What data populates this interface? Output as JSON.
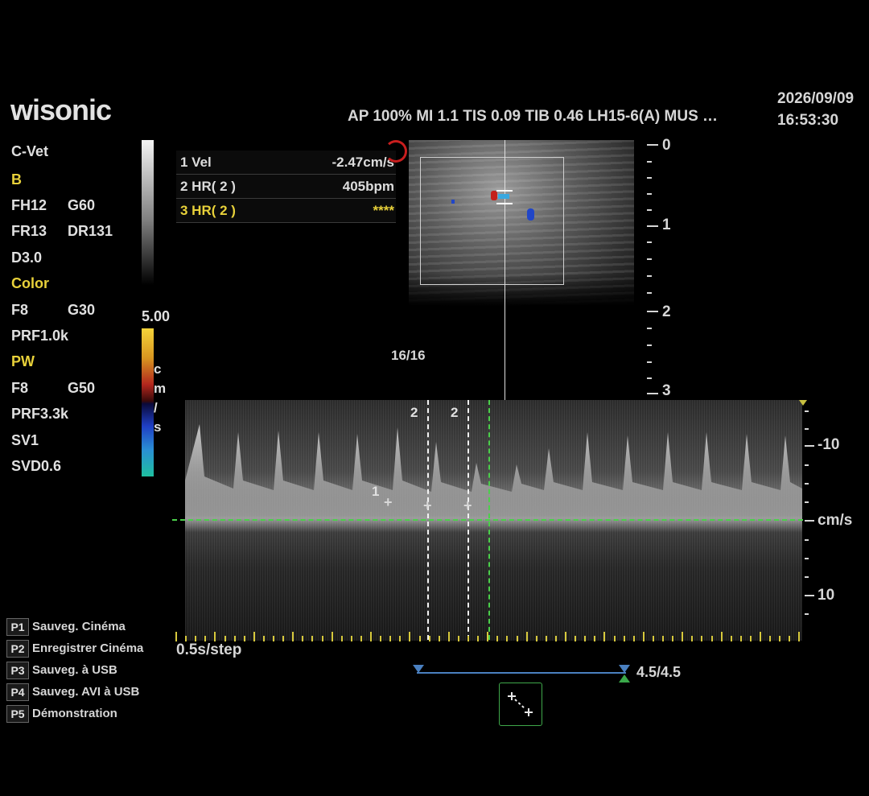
{
  "brand": {
    "logo": "wisonic"
  },
  "header": {
    "acoustic_params": "AP 100% MI 1.1 TIS 0.09  TIB 0.46  LH15-6(A)  MUS …",
    "date": "2026/09/09",
    "time": "16:53:30"
  },
  "params": {
    "preset": "C-Vet",
    "b_mode": {
      "title": "B",
      "fh": "FH12",
      "g": "G60",
      "fr": "FR13",
      "dr": "DR131",
      "d": "D3.0"
    },
    "color_mode": {
      "title": "Color",
      "f": "F8",
      "g": "G30",
      "prf": "PRF1.0k"
    },
    "pw_mode": {
      "title": "PW",
      "f": "F8",
      "g": "G50",
      "prf": "PRF3.3k",
      "sv": "SV1",
      "svd": "SVD0.6"
    }
  },
  "color_scale": {
    "max": "5.00",
    "unit_chars": [
      "c",
      "m",
      "/",
      "s"
    ]
  },
  "measurements": [
    {
      "label": "1 Vel",
      "value": "-2.47cm/s",
      "active": false
    },
    {
      "label": "2 HR( 2 )",
      "value": "405bpm",
      "active": false
    },
    {
      "label": "3 HR( 2 )",
      "value": "****",
      "active": true
    }
  ],
  "bmode": {
    "frame_counter": "16/16"
  },
  "depth_scale": {
    "labels": [
      "0",
      "1",
      "2",
      "3"
    ]
  },
  "spectral": {
    "velocity_labels": [
      "-10",
      "cm/s",
      "10"
    ],
    "time_scale": "0.5s/step",
    "caliper_labels": [
      "2",
      "2"
    ],
    "marker_label": "1",
    "cine_position": "4.5/4.5"
  },
  "presets": [
    {
      "key": "P1",
      "label": "Sauveg. Cinéma"
    },
    {
      "key": "P2",
      "label": "Enregistrer Cinéma"
    },
    {
      "key": "P3",
      "label": "Sauveg. à USB"
    },
    {
      "key": "P4",
      "label": "Sauveg. AVI à USB"
    },
    {
      "key": "P5",
      "label": "Démonstration"
    }
  ],
  "icons": {
    "caliper_tool": "caliper-icon",
    "roi_marker": "roi-marker-icon"
  },
  "colors": {
    "accent_yellow": "#e8d13a",
    "baseline_green": "#4bd04b",
    "cine_blue": "#4a80c0"
  }
}
